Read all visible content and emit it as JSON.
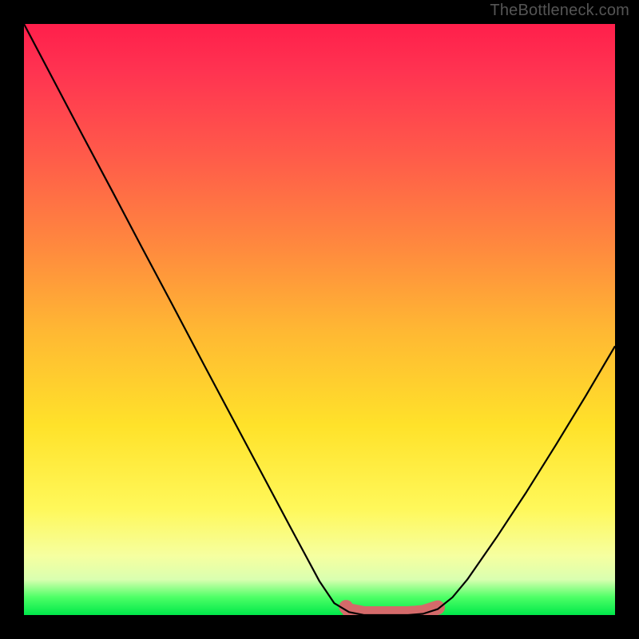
{
  "watermark": "TheBottleneck.com",
  "chart_data": {
    "type": "line",
    "title": "",
    "xlabel": "",
    "ylabel": "",
    "x": [
      0.0,
      0.05,
      0.1,
      0.15,
      0.2,
      0.25,
      0.3,
      0.35,
      0.4,
      0.45,
      0.5,
      0.525,
      0.55,
      0.575,
      0.6,
      0.625,
      0.65,
      0.675,
      0.7,
      0.725,
      0.75,
      0.8,
      0.85,
      0.9,
      0.95,
      1.0
    ],
    "values": [
      1.0,
      0.905,
      0.81,
      0.716,
      0.621,
      0.527,
      0.432,
      0.338,
      0.244,
      0.15,
      0.057,
      0.02,
      0.005,
      0.0,
      0.0,
      0.0,
      0.0,
      0.002,
      0.01,
      0.03,
      0.06,
      0.132,
      0.208,
      0.288,
      0.37,
      0.455
    ],
    "ylim": [
      0,
      1
    ],
    "xlim": [
      0,
      1
    ],
    "highlight_range_x": [
      0.55,
      0.7
    ],
    "highlight_dot_x": 0.545,
    "grid": false,
    "legend": false,
    "background": "red-yellow-green vertical gradient"
  },
  "colors": {
    "highlight": "#d46a6a",
    "line": "#000000",
    "frame": "#000000"
  }
}
